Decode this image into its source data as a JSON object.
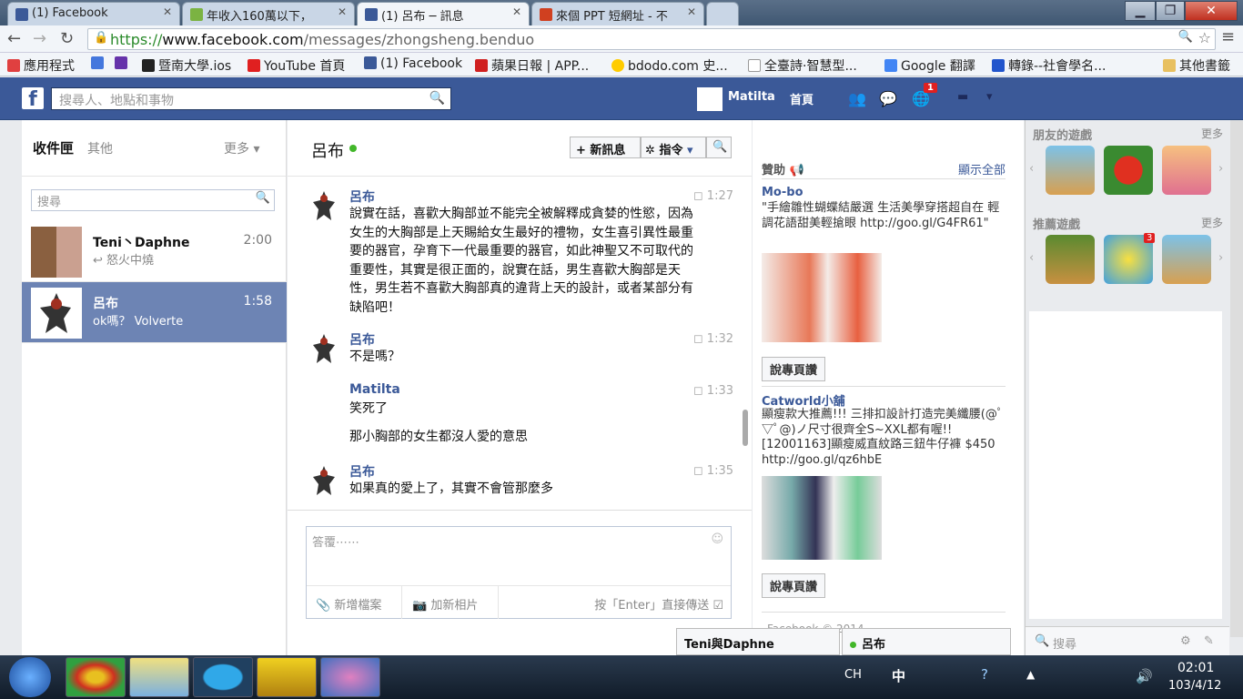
{
  "browser": {
    "tabs": [
      {
        "title": "(1) Facebook",
        "icon": "facebook-icon",
        "color": "#3b5998"
      },
      {
        "title": "年收入160萬以下，",
        "icon": "site-icon",
        "color": "#7bb342"
      },
      {
        "title": "(1) 呂布 ─ 訊息",
        "icon": "facebook-icon",
        "color": "#3b5998"
      },
      {
        "title": "來個 PPT 短網址 - 不",
        "icon": "ppt-icon",
        "color": "#d04020"
      }
    ],
    "url_https": "https://",
    "url_host": "www.facebook.com",
    "url_path": "/messages/zhongsheng.benduo",
    "bookmarks": [
      {
        "label": "應用程式",
        "color": "#e04040"
      },
      {
        "label": "",
        "color": "#4477dd"
      },
      {
        "label": "",
        "color": "#6633aa"
      },
      {
        "label": "暨南大學.ios",
        "color": "#222"
      },
      {
        "label": "YouTube 首頁",
        "color": "#e02020"
      },
      {
        "label": "(1) Facebook",
        "color": "#3b5998"
      },
      {
        "label": "蘋果日報 | APP...",
        "color": "#d02020"
      },
      {
        "label": "bdodo.com 史...",
        "color": "#ffcc00"
      },
      {
        "label": "全臺詩·智慧型...",
        "color": "#ccc"
      },
      {
        "label": "Google 翻譯",
        "color": "#4285f4"
      },
      {
        "label": "轉錄--社會學名...",
        "color": "#2255cc"
      }
    ],
    "other_bookmarks": "其他書籤"
  },
  "fb": {
    "search_placeholder": "搜尋人、地點和事物",
    "user_name": "Matilta",
    "home": "首頁",
    "notif_count": "1"
  },
  "inbox": {
    "tab_inbox": "收件匣",
    "tab_other": "其他",
    "more": "更多",
    "search_placeholder": "搜尋",
    "conversations": [
      {
        "name": "Teni丶Daphne",
        "time": "2:00",
        "preview": "怒火中燒",
        "selected": false
      },
      {
        "name": "呂布",
        "time": "1:58",
        "preview": "ok嗎？ Volverte",
        "selected": true
      }
    ]
  },
  "thread": {
    "title": "呂布",
    "new_message": "新訊息",
    "actions": "指令",
    "messages": [
      {
        "sender": "呂布",
        "time": "1:27",
        "lines": [
          "說實在話，喜歡大胸部並不能完全被解釋成貪婪的性慾，因為女生的大胸部是上天賜給女生最好的禮物，女生喜引異性最重要的器官，孕育下一代最重要的器官，如此神聖又不可取代的重要性，其實是很正面的，說實在話，男生喜歡大胸部是天性，男生若不喜歡大胸部真的違背上天的設計，或者某部分有缺陷吧！"
        ]
      },
      {
        "sender": "呂布",
        "time": "1:32",
        "lines": [
          "不是嗎？"
        ]
      },
      {
        "sender": "Matilta",
        "time": "1:33",
        "lines": [
          "笑死了",
          "那小胸部的女生都沒人愛的意思"
        ]
      },
      {
        "sender": "呂布",
        "time": "1:35",
        "lines": [
          "如果真的愛上了，其實不會管那麼多"
        ]
      }
    ],
    "reply_placeholder": "答覆⋯⋯",
    "add_file": "新增檔案",
    "add_photo": "加新相片",
    "enter_send": "按「Enter」直接傳送"
  },
  "ads": {
    "header": "贊助",
    "show_all": "顯示全部",
    "items": [
      {
        "title": "Mo-bo",
        "body": "\"手繪雛性蝴蝶結嚴選 生活美學穿搭超自在 輕調花語甜美輕搶眼 http://goo.gl/G4FR61\"",
        "like": "說專頁讚"
      },
      {
        "title": "Catworld小舖",
        "body": "顯瘦款大推薦!!! 三排扣設計打造完美纖腰(@ﾟ▽ﾟ@)ノ尺寸很齊全S~XXL都有喔!! [12001163]顯瘦威直紋路三鈕牛仔褲 $450 http://goo.gl/qz6hbE",
        "like": "說專頁讚"
      }
    ],
    "footer": "Facebook © 2014"
  },
  "games": {
    "friends_games": "朋友的遊戲",
    "recommended": "推薦遊戲",
    "more": "更多",
    "badge": "3",
    "chat_search": "搜尋"
  },
  "chat": {
    "tab1": "Teni與Daphne",
    "tab2": "呂布"
  },
  "taskbar": {
    "ime": "CH",
    "ime2": "中",
    "time": "02:01",
    "date": "103/4/12"
  }
}
